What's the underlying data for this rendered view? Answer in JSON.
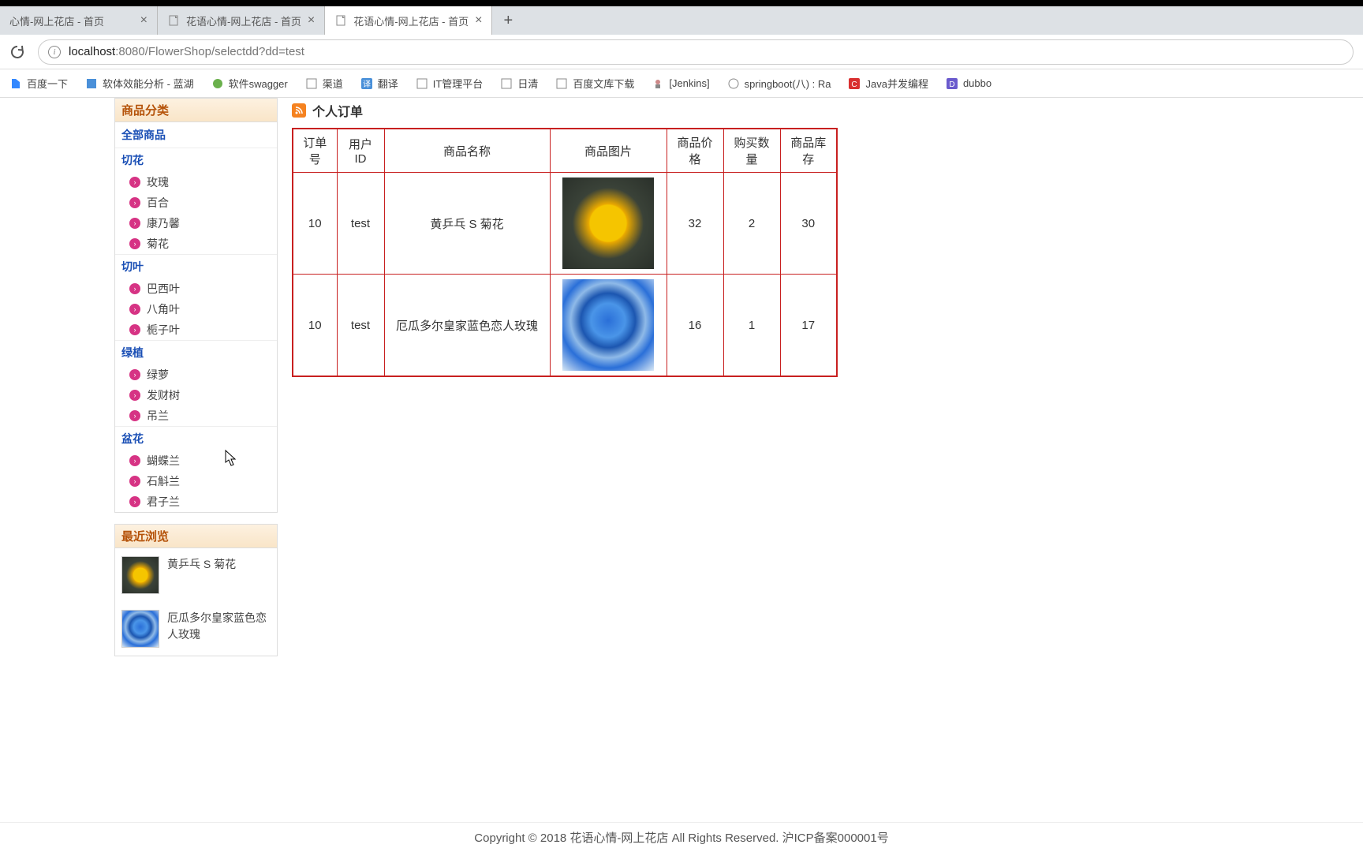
{
  "browser": {
    "tabs": [
      {
        "title": "心情-网上花店 - 首页",
        "active": false
      },
      {
        "title": "花语心情-网上花店 - 首页",
        "active": false
      },
      {
        "title": "花语心情-网上花店 - 首页",
        "active": true
      }
    ],
    "url_host": "localhost",
    "url_port": ":8080",
    "url_path": "/FlowerShop/selectdd?dd=test"
  },
  "bookmarks": [
    "百度一下",
    "软体效能分析 - 蓝湖",
    "软件swagger",
    "渠道",
    "翻译",
    "IT管理平台",
    "日清",
    "百度文库下载",
    "[Jenkins]",
    "springboot(八) : Ra",
    "Java并发编程",
    "dubbo"
  ],
  "sidebar": {
    "title": "商品分类",
    "all": "全部商品",
    "groups": [
      {
        "name": "切花",
        "items": [
          "玫瑰",
          "百合",
          "康乃馨",
          "菊花"
        ]
      },
      {
        "name": "切叶",
        "items": [
          "巴西叶",
          "八角叶",
          "栀子叶"
        ]
      },
      {
        "name": "绿植",
        "items": [
          "绿萝",
          "发财树",
          "吊兰"
        ]
      },
      {
        "name": "盆花",
        "items": [
          "蝴蝶兰",
          "石斛兰",
          "君子兰"
        ]
      }
    ]
  },
  "recent": {
    "title": "最近浏览",
    "items": [
      {
        "name": "黄乒乓 S 菊花",
        "thumb": "yellow-flower"
      },
      {
        "name": "厄瓜多尔皇家蓝色恋人玫瑰",
        "thumb": "blue-rose"
      }
    ]
  },
  "main": {
    "title": "个人订单",
    "headers": [
      "订单号",
      "用户ID",
      "商品名称",
      "商品图片",
      "商品价格",
      "购买数量",
      "商品库存"
    ],
    "rows": [
      {
        "order_id": "10",
        "user_id": "test",
        "name": "黄乒乓 S 菊花",
        "img": "yellow-flower",
        "price": "32",
        "qty": "2",
        "stock": "30"
      },
      {
        "order_id": "10",
        "user_id": "test",
        "name": "厄瓜多尔皇家蓝色恋人玫瑰",
        "img": "blue-rose",
        "price": "16",
        "qty": "1",
        "stock": "17"
      }
    ]
  },
  "footer": "Copyright © 2018 花语心情-网上花店 All Rights Reserved. 沪ICP备案000001号"
}
